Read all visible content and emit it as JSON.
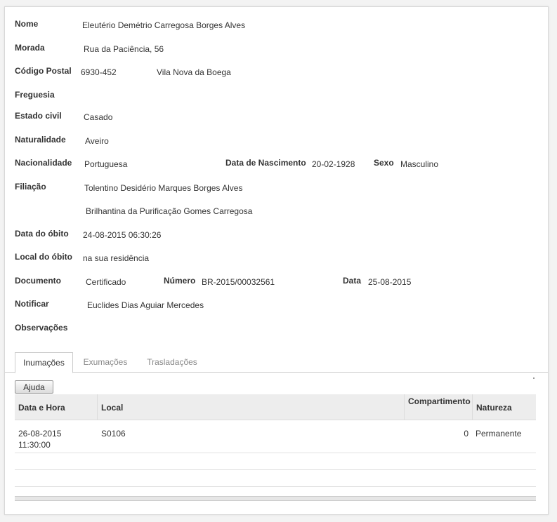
{
  "fields": {
    "nome": {
      "label": "Nome",
      "value": "Eleutério Demétrio Carregosa Borges Alves"
    },
    "morada": {
      "label": "Morada",
      "value": "Rua da Paciência, 56"
    },
    "codigo_postal": {
      "label": "Código Postal",
      "value": "6930-452",
      "localidade": "Vila Nova da Boega"
    },
    "freguesia": {
      "label": "Freguesia",
      "value": ""
    },
    "estado_civil": {
      "label": "Estado civil",
      "value": "Casado"
    },
    "naturalidade": {
      "label": "Naturalidade",
      "value": "Aveiro"
    },
    "nacionalidade": {
      "label": "Nacionalidade",
      "value": "Portuguesa"
    },
    "data_nascimento": {
      "label": "Data de Nascimento",
      "value": "20-02-1928"
    },
    "sexo": {
      "label": "Sexo",
      "value": "Masculino"
    },
    "filiacao": {
      "label": "Filiação",
      "pai": "Tolentino Desidério Marques Borges Alves",
      "mae": "Brilhantina da Purificação Gomes Carregosa"
    },
    "data_obito": {
      "label": "Data do óbito",
      "value": "24-08-2015 06:30:26"
    },
    "local_obito": {
      "label": "Local do óbito",
      "value": "na sua residência"
    },
    "documento": {
      "label": "Documento",
      "value": "Certificado"
    },
    "numero": {
      "label": "Número",
      "value": "BR-2015/00032561"
    },
    "data": {
      "label": "Data",
      "value": "25-08-2015"
    },
    "notificar": {
      "label": "Notificar",
      "value": "Euclides Dias Aguiar Mercedes"
    },
    "observacoes": {
      "label": "Observações",
      "value": ""
    }
  },
  "tabs": [
    {
      "label": "Inumações",
      "active": true
    },
    {
      "label": "Exumações",
      "active": false
    },
    {
      "label": "Trasladações",
      "active": false
    }
  ],
  "help_button": "Ajuda",
  "grid": {
    "columns": [
      "Data e Hora",
      "Local",
      "Compartimento",
      "Natureza"
    ],
    "rows": [
      {
        "data_hora_line1": "26-08-2015",
        "data_hora_line2": "11:30:00",
        "local": "S0106",
        "compartimento": "0",
        "natureza": "Permanente"
      }
    ]
  }
}
